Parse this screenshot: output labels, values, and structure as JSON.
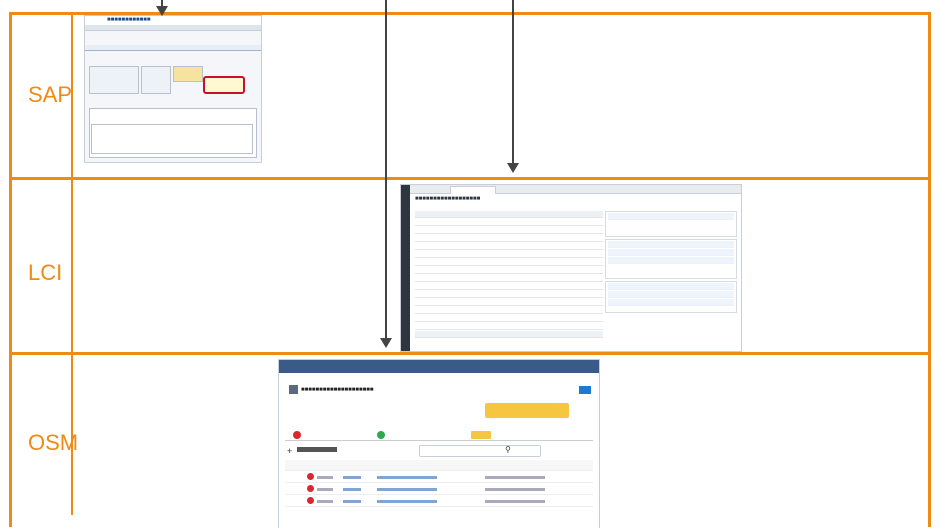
{
  "labels": {
    "sap": "SAP",
    "lci": "LCI",
    "osm": "OSM"
  },
  "colors": {
    "border": "#ef8a12",
    "arrow": "#444444"
  }
}
